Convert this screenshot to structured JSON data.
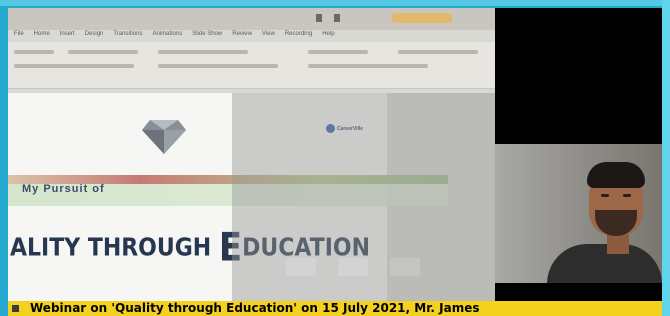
{
  "ribbon": {
    "tabs": [
      "File",
      "Home",
      "Insert",
      "Design",
      "Transitions",
      "Animations",
      "Slide Show",
      "Review",
      "View",
      "Recording",
      "Help"
    ]
  },
  "slide": {
    "subtitle": "My Pursuit of",
    "title_prefix": "ALITY THROUGH ",
    "title_initial": "E",
    "title_suffix": "DUCATION",
    "logo_text": "CareerVille"
  },
  "caption": {
    "text": "Webinar on 'Quality through Education' on 15 July 2021, Mr. James"
  },
  "colors": {
    "frame": "#25a9cf",
    "caption_bg": "#f3d11e",
    "title_color": "#27374f"
  }
}
